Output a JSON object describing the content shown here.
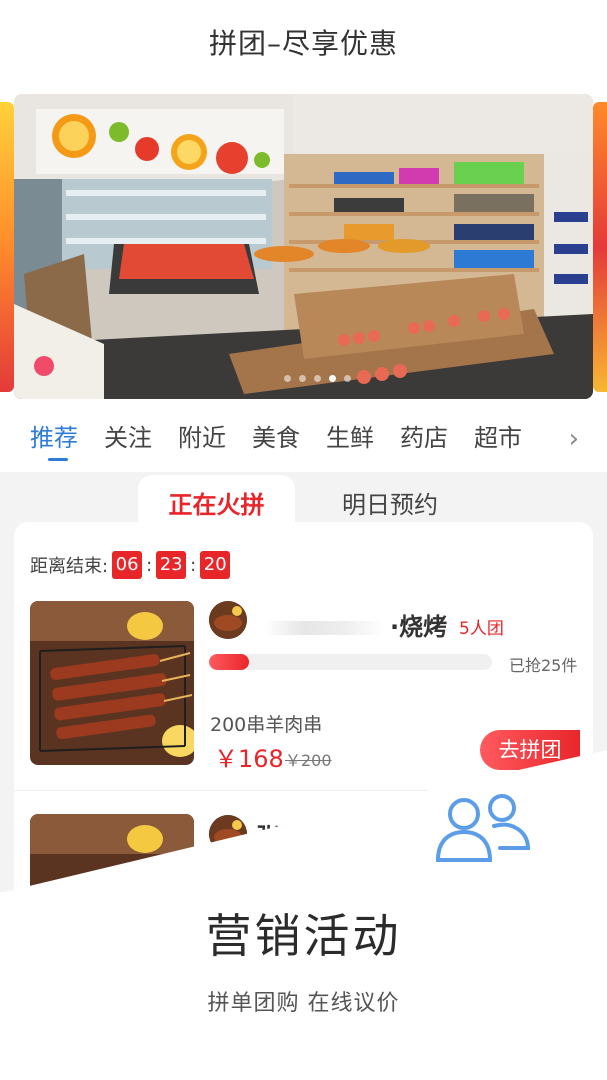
{
  "header": {
    "title": "拼团–尽享优惠"
  },
  "categories": [
    "推荐",
    "关注",
    "附近",
    "美食",
    "生鲜",
    "药店",
    "超市"
  ],
  "subtabs": {
    "active": "正在火拼",
    "inactive": "明日预约"
  },
  "countdown": {
    "label": "距离结束:",
    "h": "06",
    "m": "23",
    "s": "20"
  },
  "product": {
    "shop_suffix": "·烧烤",
    "group_size": "5人团",
    "progress": 0.14,
    "sold": "已抢25件",
    "name": "200串羊肉串",
    "price": "￥168",
    "orig_price": "￥200",
    "join": "去拼团"
  },
  "product2": {
    "shop_partial": "张胖"
  },
  "feature": {
    "title": "营销活动",
    "subtitle": "拼单团购 在线议价"
  },
  "colors": {
    "accent": "#2f7bd8",
    "red": "#e8262a"
  },
  "icons": {
    "more": "chevron-right-icon",
    "group": "people-icon"
  }
}
